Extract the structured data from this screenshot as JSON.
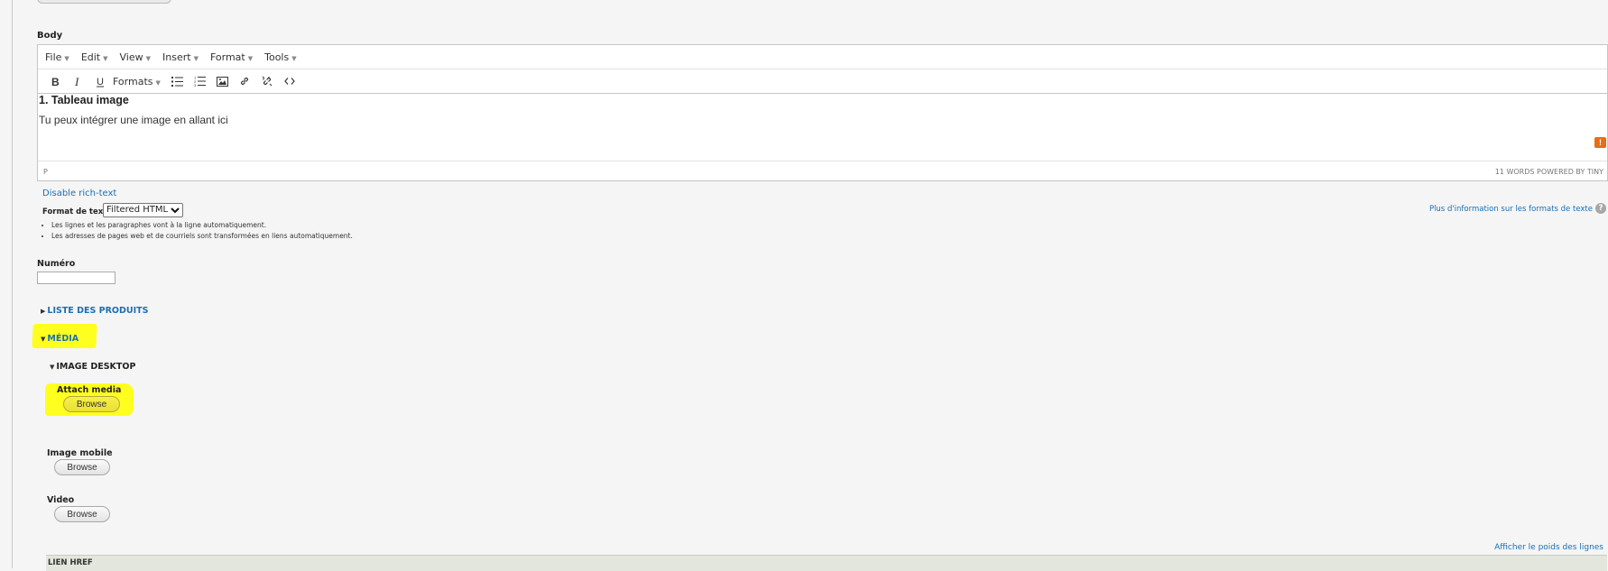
{
  "body_label": "Body",
  "editor": {
    "menu": [
      "File",
      "Edit",
      "View",
      "Insert",
      "Format",
      "Tools"
    ],
    "toolbar_formats": "Formats",
    "heading": "1. Tableau image",
    "paragraph": "Tu peux intégrer une image en allant ici",
    "warning_badge": "!",
    "status_path": "P",
    "word_count": "11 WORDS POWERED BY TINY"
  },
  "disable_rich_text": "Disable rich-text",
  "text_format": {
    "label": "Format de texte",
    "selected": "Filtered HTML",
    "more_info": "Plus d'information sur les formats de texte",
    "help": "?",
    "tips": [
      "Les lignes et les paragraphes vont à la ligne automatiquement.",
      "Les adresses de pages web et de courriels sont transformées en liens automatiquement."
    ]
  },
  "numero": {
    "label": "Numéro",
    "value": ""
  },
  "liste_produits": "LISTE DES PRODUITS",
  "media": {
    "label": "MÉDIA",
    "image_desktop": "IMAGE DESKTOP",
    "attach_media": "Attach media",
    "browse": "Browse",
    "image_mobile": "Image mobile",
    "video": "Video"
  },
  "show_weights": "Afficher le poids des lignes",
  "lien_href": "LIEN HREF",
  "colors": {
    "link": "#1a6fb5",
    "highlight": "#ffff1f",
    "badge": "#e86d17"
  }
}
